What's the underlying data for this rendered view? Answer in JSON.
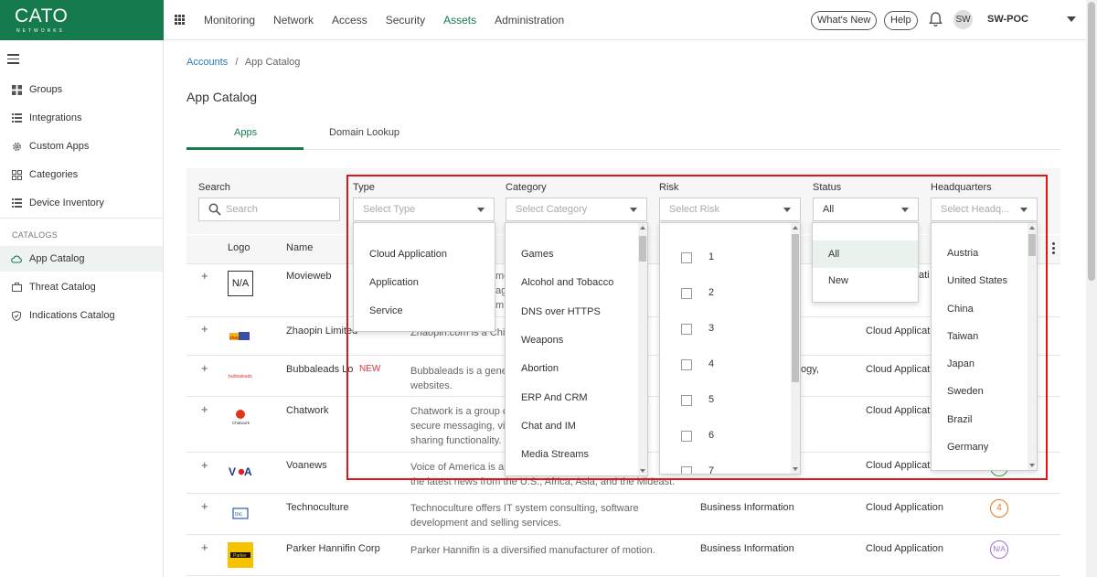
{
  "brand": {
    "name": "CATO",
    "sub": "NETWORKS"
  },
  "nav": [
    "Monitoring",
    "Network",
    "Access",
    "Security",
    "Assets",
    "Administration"
  ],
  "nav_active": "Assets",
  "header": {
    "whats_new": "What's New",
    "help": "Help",
    "avatar": "SW",
    "org": "SW-POC"
  },
  "sidebar": {
    "items": [
      {
        "label": "Groups",
        "icon": "groups-icon"
      },
      {
        "label": "Integrations",
        "icon": "list-icon"
      },
      {
        "label": "Custom Apps",
        "icon": "gear-icon"
      },
      {
        "label": "Categories",
        "icon": "categories-icon"
      },
      {
        "label": "Device Inventory",
        "icon": "list-icon"
      }
    ],
    "section": "CATALOGS",
    "catalogs": [
      {
        "label": "App Catalog",
        "icon": "cloud-icon",
        "active": true
      },
      {
        "label": "Threat Catalog",
        "icon": "briefcase-icon"
      },
      {
        "label": "Indications Catalog",
        "icon": "shield-icon"
      }
    ]
  },
  "breadcrumb": {
    "root": "Accounts",
    "sep": "/",
    "current": "App Catalog"
  },
  "page_title": "App Catalog",
  "tabs": [
    "Apps",
    "Domain Lookup"
  ],
  "filters": {
    "search": {
      "label": "Search",
      "placeholder": "Search"
    },
    "type": {
      "label": "Type",
      "placeholder": "Select Type"
    },
    "category": {
      "label": "Category",
      "placeholder": "Select Category"
    },
    "risk": {
      "label": "Risk",
      "placeholder": "Select Risk"
    },
    "status": {
      "label": "Status",
      "value": "All"
    },
    "hq": {
      "label": "Headquarters",
      "placeholder": "Select Headq..."
    }
  },
  "table": {
    "headers": {
      "logo": "Logo",
      "name": "Name"
    },
    "rows": [
      {
        "logo": "N/A",
        "name": "Movieweb",
        "desc_visible": "me",
        "desc_visible2": "ag",
        "desc_visible3": "m",
        "type_fragment": "ati"
      },
      {
        "name": "Zhaopin Limited",
        "desc": "Zhaopin.com is a Chin",
        "desc_tail": "vic",
        "type": "Cloud Applicati"
      },
      {
        "name": "Bubbaleads Lo",
        "tag": "NEW",
        "desc": "Bubbaleads is a gener",
        "desc2": "websites.",
        "cat_fragment": "ogy,",
        "type": "Cloud Applicati"
      },
      {
        "name": "Chatwork",
        "desc": "Chatwork is a group ch",
        "desc2": "secure messaging, vid",
        "desc3": "sharing functionality.",
        "desc_tail": "les",
        "type": "Cloud Applicati"
      },
      {
        "name": "Voanews",
        "desc": "Voice of America is an",
        "desc_tail": "of",
        "desc2": "the latest news from the U.S., Africa, Asia, and the Mideast.",
        "type": "Cloud Applicati"
      },
      {
        "name": "Technoculture",
        "desc": "Technoculture offers IT system consulting, software",
        "desc2": "development and selling services.",
        "category": "Business Information",
        "type": "Cloud Application",
        "risk": "4"
      },
      {
        "name": "Parker Hannifin Corp",
        "desc": "Parker Hannifin is a diversified manufacturer of motion.",
        "category": "Business Information",
        "type": "Cloud Application",
        "risk": "N/A"
      }
    ]
  },
  "dropdowns": {
    "type": [
      "Cloud Application",
      "Application",
      "Service"
    ],
    "category": [
      "Games",
      "Alcohol and Tobacco",
      "DNS over HTTPS",
      "Weapons",
      "Abortion",
      "ERP And CRM",
      "Chat and IM",
      "Media Streams"
    ],
    "risk": [
      "1",
      "2",
      "3",
      "4",
      "5",
      "6",
      "7"
    ],
    "status": [
      "All",
      "New"
    ],
    "hq": [
      "Austria",
      "United States",
      "China",
      "Taiwan",
      "Japan",
      "Sweden",
      "Brazil",
      "Germany"
    ]
  },
  "colors": {
    "brand": "#157a4c",
    "highlight": "#e0151b",
    "risk_4": "#e8761b",
    "risk_na": "#9b6fd6",
    "risk_green": "#2fa35a"
  }
}
